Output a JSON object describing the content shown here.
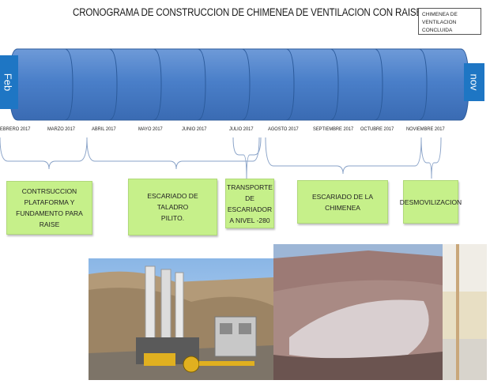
{
  "title": "CRONOGRAMA DE CONSTRUCCION DE CHIMENEA DE VENTILACION CON RAISE BORING",
  "status_note": "CHIMENEA DE VENTILACION CONCLUIDA",
  "timeline": {
    "start_label": "Feb",
    "end_label": "nov",
    "months": [
      "EBRERO 2017",
      "MARZO 2017",
      "ABRIL 2017",
      "MAYO 2017",
      "JUNIO 2017",
      "JULIO 2017",
      "AGOSTO 2017",
      "SEPTIEMBRE 2017",
      "OCTUBRE 2017",
      "NOVIEMBRE 2017"
    ]
  },
  "phases": [
    {
      "label": "CONTRSUCCION\nPLATAFORMA Y\nFUNDAMENTO PARA RAISE"
    },
    {
      "label": "ESCARIADO DE TALADRO\nPILITO."
    },
    {
      "label": "TRANSPORTE\nDE ESCARIADOR\nA NIVEL -280"
    },
    {
      "label": "ESCARIADO DE LA CHIMENEA"
    },
    {
      "label": "DESMOVILIZACION"
    }
  ],
  "colors": {
    "cylinder": "#4a7fc9",
    "cylinder_edge": "#2b5a9a",
    "end_cap": "#1e76c4",
    "phase_box": "#c6f08a"
  },
  "photos": [
    {
      "name": "raise-boring-machine-photo"
    },
    {
      "name": "ventilation-shaft-site-photo"
    }
  ]
}
